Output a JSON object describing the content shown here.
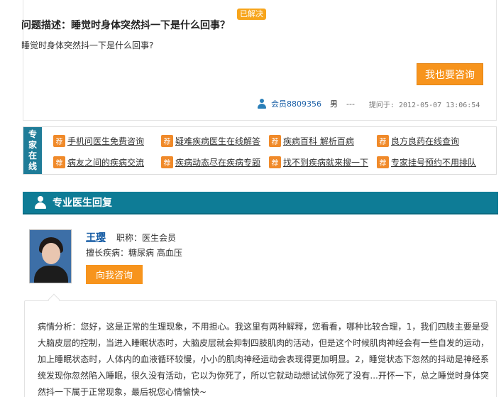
{
  "question": {
    "title": "问题描述：睡觉时身体突然抖一下是什么回事？",
    "badge": "已解决",
    "body": "睡觉时身体突然抖一下是什么回事?",
    "ask_button": "我也要咨询",
    "member": "会员8809356",
    "gender": "男",
    "age": "---",
    "time": "提问于: 2012-05-07 13:06:54"
  },
  "expert": {
    "tag": [
      "专",
      "家",
      "在",
      "线"
    ],
    "badge_char": "荐",
    "links_row1": [
      "手机问医生免费咨询",
      "疑难疾病医生在线解答",
      "疾病百科 解析百病",
      "良方良药在线查询"
    ],
    "links_row2": [
      "病友之间的疾病交流",
      "疾病动态尽在疾病专题",
      "找不到疾病就来搜一下",
      "专家挂号预约不用排队"
    ]
  },
  "section": {
    "title": "专业医生回复"
  },
  "doctor": {
    "name": "王璎",
    "title_text": "职称：医生会员",
    "specialty": "擅长疾病：糖尿病 高血压",
    "consult_button": "向我咨询"
  },
  "analysis": {
    "text": "病情分析：您好，这是正常的生理现象，不用担心。我这里有两种解释，您看看，哪种比较合理，1，我们四肢主要是受大脑皮层的控制，当进入睡眠状态时，大脑皮层就会抑制四肢肌肉的活动，但是这个时候肌肉神经会有一些自发的运动，加上睡眠状态时，人体内的血液循环较慢，小小的肌肉神经运动会表现得更加明显。2，睡觉状态下忽然的抖动是神经系统发现你忽然陷入睡眠，很久没有活动，它以为你死了，所以它就动动想试试你死了没有...开怀一下，总之睡觉时身体突然抖一下属于正常现象，最后祝您心情愉快~"
  },
  "colors": {
    "accent_orange": "#f7941d",
    "teal": "#0e7c96",
    "link_blue": "#1a5fa6"
  }
}
